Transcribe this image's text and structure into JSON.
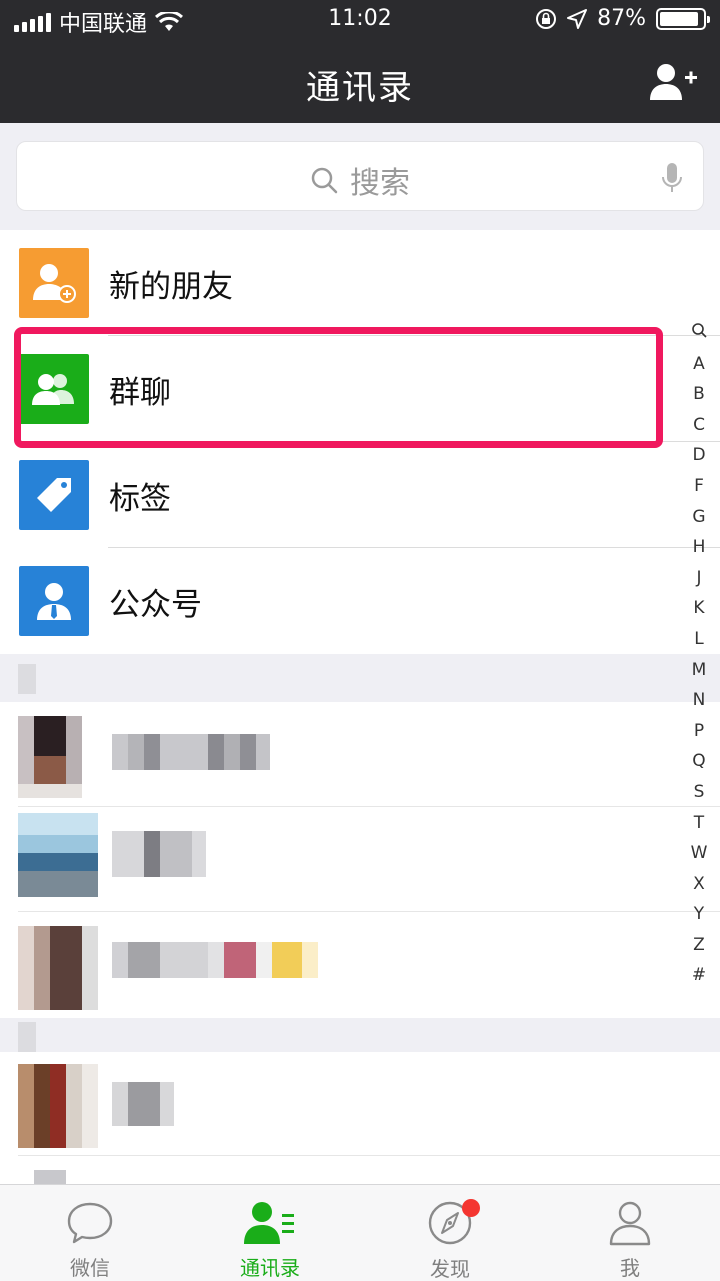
{
  "status_bar": {
    "carrier": "中国联通",
    "time": "11:02",
    "battery": "87%",
    "battery_level": 0.87
  },
  "nav": {
    "title": "通讯录",
    "add_icon": "add-friend-icon"
  },
  "search": {
    "placeholder": "搜索"
  },
  "menu_items": [
    {
      "label": "新的朋友",
      "icon": "new-friend-icon",
      "color": "#f69c32"
    },
    {
      "label": "群聊",
      "icon": "group-chat-icon",
      "color": "#1aad19"
    },
    {
      "label": "标签",
      "icon": "tag-icon",
      "color": "#2782d7"
    },
    {
      "label": "公众号",
      "icon": "official-account-icon",
      "color": "#2782d7"
    }
  ],
  "index_letters": [
    "Q",
    "A",
    "B",
    "C",
    "D",
    "F",
    "G",
    "H",
    "J",
    "K",
    "L",
    "M",
    "N",
    "P",
    "Q",
    "S",
    "T",
    "W",
    "X",
    "Y",
    "Z",
    "#"
  ],
  "tabs": [
    {
      "label": "微信",
      "icon": "chat-bubble-icon",
      "active": false
    },
    {
      "label": "通讯录",
      "icon": "contacts-icon",
      "active": true
    },
    {
      "label": "发现",
      "icon": "compass-icon",
      "active": false,
      "badge": true
    },
    {
      "label": "我",
      "icon": "profile-icon",
      "active": false
    }
  ],
  "colors": {
    "accent": "#1aad19",
    "highlight": "#f0185e",
    "header": "#2b2b2e"
  }
}
